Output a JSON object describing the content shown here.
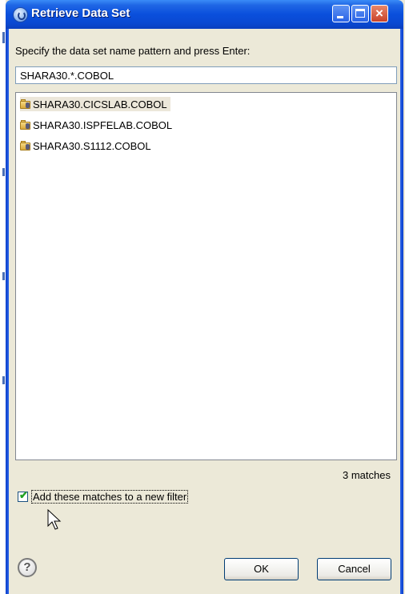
{
  "window": {
    "title": "Retrieve Data Set",
    "buttons": {
      "minimize": "minimize",
      "maximize": "maximize",
      "close": "×"
    }
  },
  "instruction": "Specify the data set name pattern and press Enter:",
  "pattern_input": {
    "value": "SHARA30.*.COBOL"
  },
  "results": {
    "items": [
      {
        "label": "SHARA30.CICSLAB.COBOL",
        "selected": true
      },
      {
        "label": "SHARA30.ISPFELAB.COBOL",
        "selected": false
      },
      {
        "label": "SHARA30.S1112.COBOL",
        "selected": false
      }
    ],
    "match_count": "3 matches"
  },
  "options": {
    "add_to_filter": {
      "label": "Add these matches to a new filter",
      "checked": true
    }
  },
  "footer": {
    "help_glyph": "?",
    "ok_label": "OK",
    "cancel_label": "Cancel"
  },
  "colors": {
    "title_bar": "#0a4fdc",
    "dialog_bg": "#ece9d8",
    "selected_row": "#ece7da"
  }
}
